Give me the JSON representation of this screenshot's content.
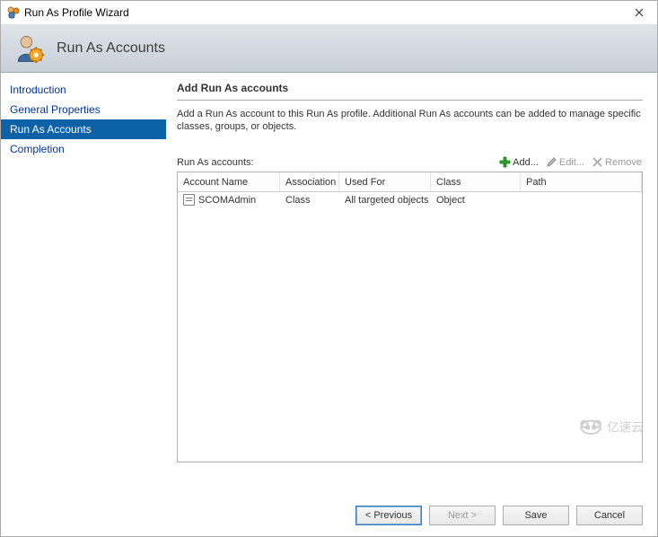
{
  "window": {
    "title": "Run As Profile Wizard"
  },
  "banner": {
    "title": "Run As Accounts"
  },
  "sidebar": {
    "items": [
      {
        "label": "Introduction",
        "selected": false
      },
      {
        "label": "General Properties",
        "selected": false
      },
      {
        "label": "Run As Accounts",
        "selected": true
      },
      {
        "label": "Completion",
        "selected": false
      }
    ]
  },
  "main": {
    "heading": "Add Run As accounts",
    "description": "Add a Run As account to this Run As profile.  Additional Run As accounts can be added to manage specific classes, groups, or objects.",
    "list_label": "Run As accounts:",
    "toolbar": {
      "add": "Add...",
      "edit": "Edit...",
      "remove": "Remove"
    },
    "columns": {
      "account_name": "Account Name",
      "association": "Association",
      "used_for": "Used For",
      "class": "Class",
      "path": "Path"
    },
    "rows": [
      {
        "account_name": "SCOMAdmin",
        "association": "Class",
        "used_for": "All targeted objects",
        "class": "Object",
        "path": ""
      }
    ]
  },
  "buttons": {
    "previous": "< Previous",
    "next": "Next >",
    "save": "Save",
    "cancel": "Cancel"
  },
  "watermark": {
    "text": "亿速云"
  }
}
